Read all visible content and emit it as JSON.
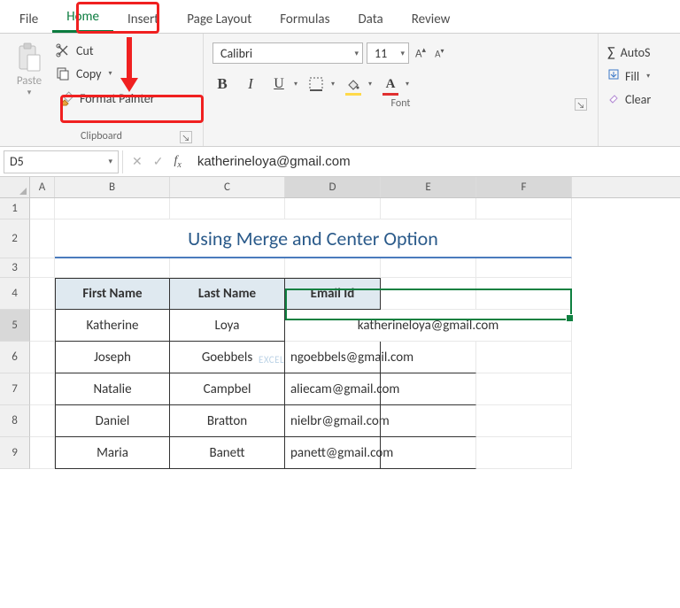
{
  "tabs": {
    "file": "File",
    "home": "Home",
    "insert": "Insert",
    "page_layout": "Page Layout",
    "formulas": "Formulas",
    "data": "Data",
    "review": "Review"
  },
  "clipboard": {
    "paste": "Paste",
    "cut": "Cut",
    "copy": "Copy",
    "format_painter": "Format Painter",
    "group_label": "Clipboard"
  },
  "font": {
    "name": "Calibri",
    "size": "11",
    "group_label": "Font"
  },
  "editing": {
    "autosum": "AutoS",
    "fill": "Fill",
    "clear": "Clear"
  },
  "namebox": "D5",
  "formula": "katherineloya@gmail.com",
  "columns": {
    "A": "A",
    "B": "B",
    "C": "C",
    "D": "D",
    "E": "E",
    "F": "F"
  },
  "rows": [
    "1",
    "2",
    "3",
    "4",
    "5",
    "6",
    "7",
    "8",
    "9"
  ],
  "title": "Using Merge and Center Option",
  "table": {
    "headers": {
      "first": "First Name",
      "last": "Last Name",
      "email": "Email Id"
    },
    "rows": [
      {
        "first": "Katherine",
        "last": "Loya",
        "email": "katherineloya@gmail.com"
      },
      {
        "first": "Joseph",
        "last": "Goebbels",
        "email": "ngoebbels@gmail.com"
      },
      {
        "first": "Natalie",
        "last": "Campbel",
        "email": "aliecam@gmail.com"
      },
      {
        "first": "Daniel",
        "last": "Bratton",
        "email": "nielbr@gmail.com"
      },
      {
        "first": "Maria",
        "last": "Banett",
        "email": "panett@gmail.com"
      }
    ]
  },
  "annotations": {
    "highlight_home": true,
    "highlight_format_painter": true
  },
  "watermark": "EXCEL · DATA · BI"
}
